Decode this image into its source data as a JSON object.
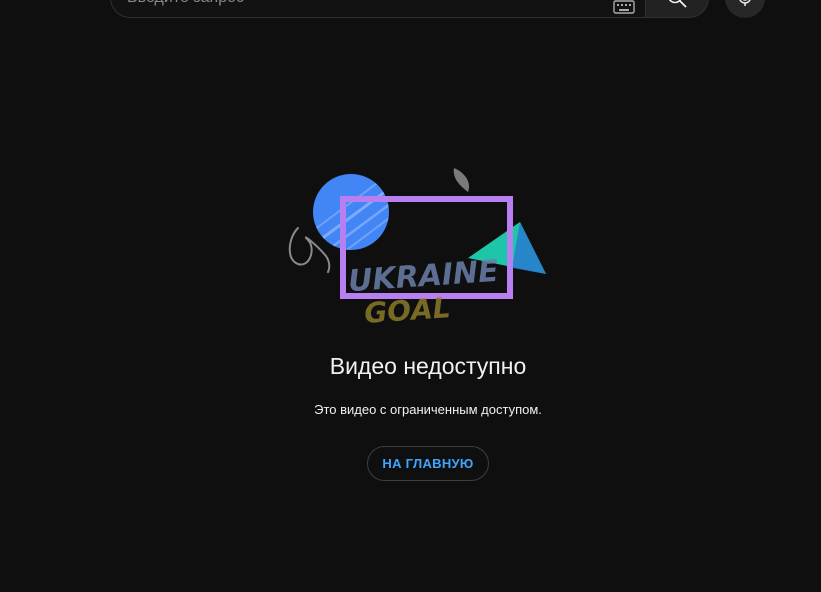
{
  "search": {
    "placeholder": "Введите запрос"
  },
  "icons": {
    "keyboard": "keyboard-icon",
    "search": "search-icon",
    "mic": "microphone-icon"
  },
  "illustration": {
    "watermark_line1": "UKRAINE",
    "watermark_line2": "GOAL"
  },
  "message": {
    "title": "Видео недоступно",
    "subtitle": "Это видео с ограниченным доступом.",
    "home_button": "НА ГЛАВНУЮ"
  },
  "colors": {
    "background": "#0f0f0f",
    "accent_link": "#3ea6ff",
    "circle_blue": "#4285f4",
    "frame_purple": "#b77fef",
    "triangle_teal": "#1dc6a8",
    "text": "#f1f1f1"
  }
}
